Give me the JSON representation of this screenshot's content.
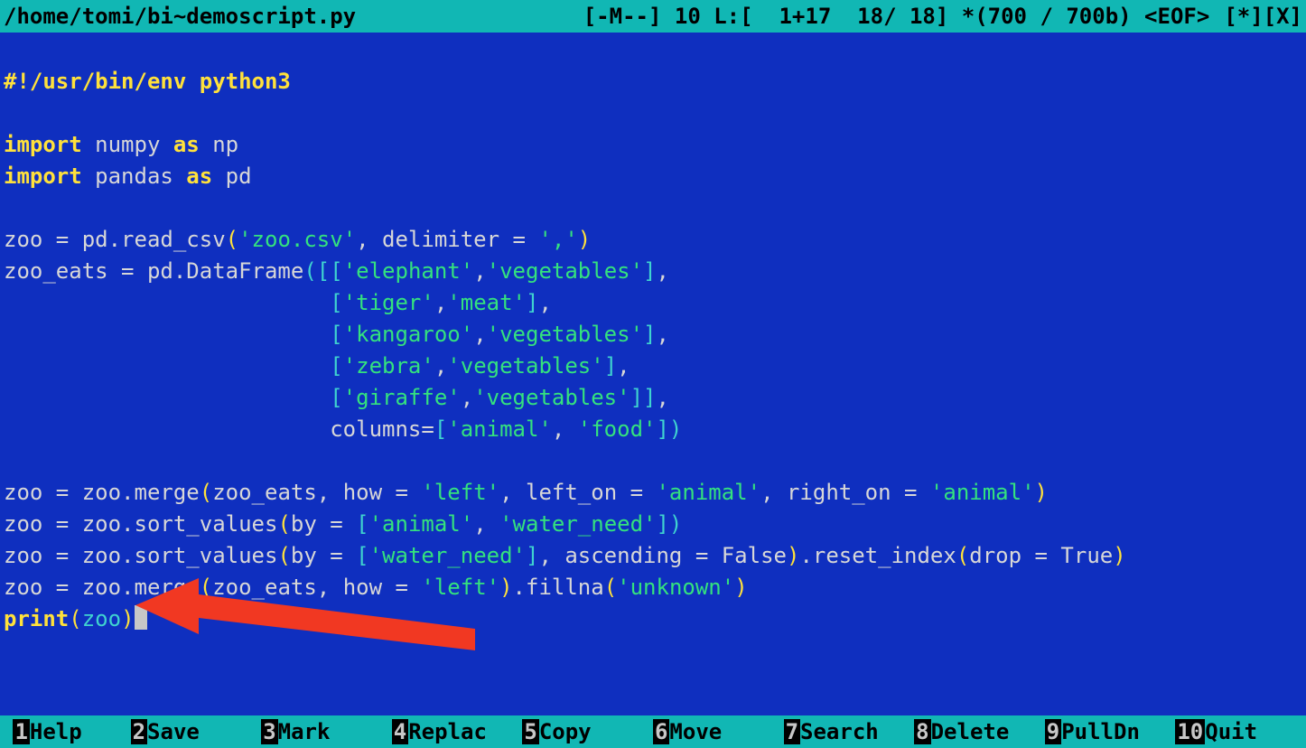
{
  "title": {
    "path": "/home/tomi/bi~demoscript.py",
    "status": "[-M--] 10 L:[  1+17  18/ 18] *(700 / 700b) <EOF>",
    "right": "[*][X]"
  },
  "code": {
    "l1a": "#!/usr/bin/env python3",
    "l2": "",
    "l3a": "import",
    "l3b": " numpy ",
    "l3c": "as",
    "l3d": " np",
    "l4a": "import",
    "l4b": " pandas ",
    "l4c": "as",
    "l4d": " pd",
    "l5": "",
    "l6a": "zoo = pd.read_csv",
    "l6b": "(",
    "l6c": "'zoo.csv'",
    "l6d": ", delimiter = ",
    "l6e": "','",
    "l6f": ")",
    "l7a": "zoo_eats = pd.DataFrame",
    "l7b": "([[",
    "l7c": "'elephant'",
    "l7d": ",",
    "l7e": "'vegetables'",
    "l7f": "]",
    "l7g": ",",
    "l8pad": "                         ",
    "l8b": "[",
    "l8c": "'tiger'",
    "l8d": ",",
    "l8e": "'meat'",
    "l8f": "]",
    "l8g": ",",
    "l9b": "[",
    "l9c": "'kangaroo'",
    "l9d": ",",
    "l9e": "'vegetables'",
    "l9f": "]",
    "l9g": ",",
    "l10b": "[",
    "l10c": "'zebra'",
    "l10d": ",",
    "l10e": "'vegetables'",
    "l10f": "]",
    "l10g": ",",
    "l11b": "[",
    "l11c": "'giraffe'",
    "l11d": ",",
    "l11e": "'vegetables'",
    "l11f": "]]",
    "l11g": ",",
    "l12a": "                         columns=",
    "l12b": "[",
    "l12c": "'animal'",
    "l12d": ", ",
    "l12e": "'food'",
    "l12f": "])",
    "l13": "",
    "l14a": "zoo = zoo.merge",
    "l14b": "(",
    "l14c": "zoo_eats, how = ",
    "l14d": "'left'",
    "l14e": ", left_on = ",
    "l14f": "'animal'",
    "l14g": ", right_on = ",
    "l14h": "'animal'",
    "l14i": ")",
    "l15a": "zoo = zoo.sort_values",
    "l15b": "(",
    "l15c": "by = ",
    "l15d": "[",
    "l15e": "'animal'",
    "l15f": ", ",
    "l15g": "'water_need'",
    "l15h": "])",
    "l16a": "zoo = zoo.sort_values",
    "l16b": "(",
    "l16c": "by = ",
    "l16d": "[",
    "l16e": "'water_need'",
    "l16f": "]",
    "l16g": ", ascending = False",
    "l16h": ")",
    "l16i": ".reset_index",
    "l16j": "(",
    "l16k": "drop = True",
    "l16l": ")",
    "l17a": "zoo = zoo.merge",
    "l17b": "(",
    "l17c": "zoo_eats, how = ",
    "l17d": "'left'",
    "l17e": ")",
    "l17f": ".fillna",
    "l17g": "(",
    "l17h": "'unknown'",
    "l17i": ")",
    "l18a": "print",
    "l18b": "(",
    "l18c": "zoo",
    "l18d": ")"
  },
  "footer": [
    {
      "n": "1",
      "label": "Help"
    },
    {
      "n": "2",
      "label": "Save"
    },
    {
      "n": "3",
      "label": "Mark"
    },
    {
      "n": "4",
      "label": "Replac"
    },
    {
      "n": "5",
      "label": "Copy"
    },
    {
      "n": "6",
      "label": "Move"
    },
    {
      "n": "7",
      "label": "Search"
    },
    {
      "n": "8",
      "label": "Delete"
    },
    {
      "n": "9",
      "label": "PullDn"
    },
    {
      "n": "10",
      "label": "Quit"
    }
  ]
}
